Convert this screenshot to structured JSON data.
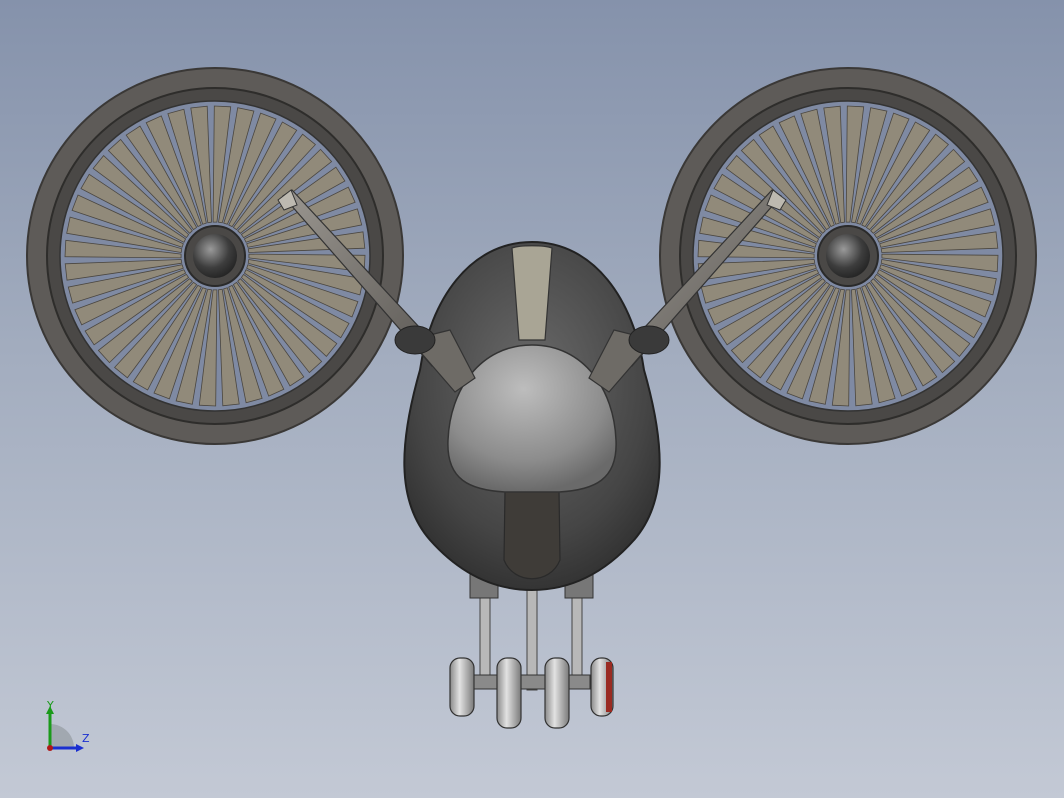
{
  "viewport": {
    "background_top": "#8592ab",
    "background_bottom": "#c3c9d5"
  },
  "model": {
    "name": "tilt-rotor-drone",
    "parts": [
      "left-ducted-fan",
      "right-ducted-fan",
      "fuselage",
      "nose-cone",
      "left-strut-arm",
      "right-strut-arm",
      "landing-gear"
    ],
    "fan_blade_count": 40,
    "colors": {
      "duct": "#5e5b58",
      "blade": "#918a7a",
      "fuselage": "#4a4a4a",
      "nose": "#8f8f8f",
      "stripe": "#a9a595",
      "wheel": "#c9c9c9",
      "accent_red": "#9a2b22"
    }
  },
  "triad": {
    "y_label": "Y",
    "z_label": "Z",
    "y_color": "#1a9a1a",
    "z_color": "#1a2fd0",
    "origin_color": "#b01818"
  }
}
